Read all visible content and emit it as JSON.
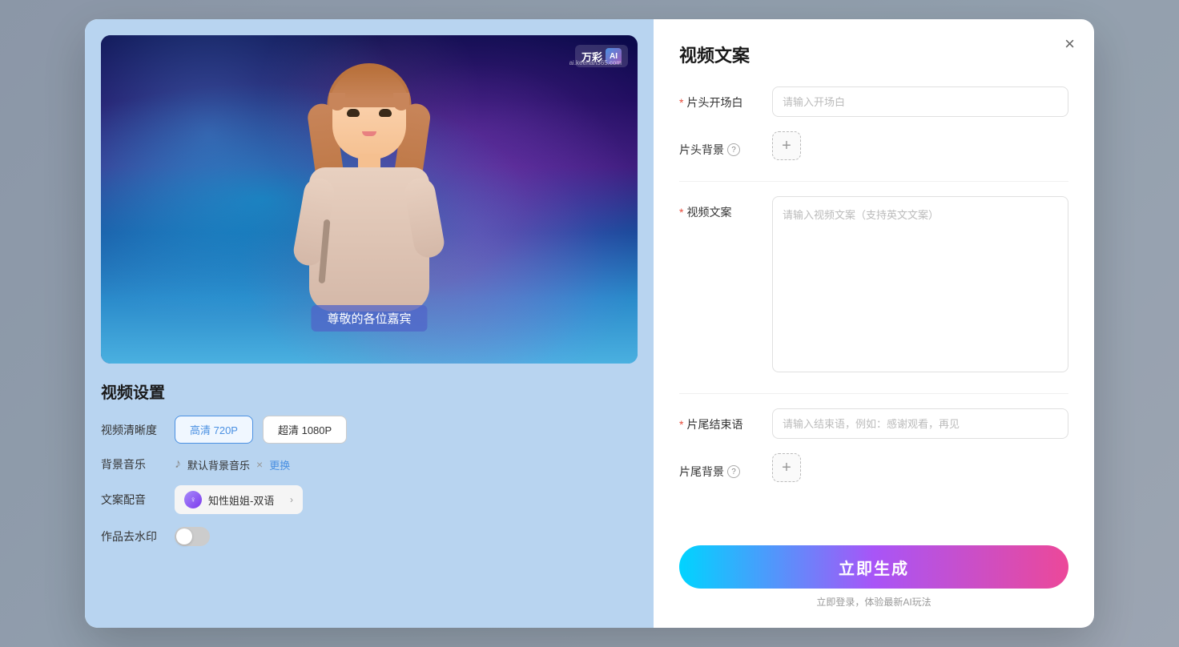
{
  "modal": {
    "close_label": "×",
    "left": {
      "watermark": {
        "brand": "万彩",
        "ai": "AI",
        "url": "ai.keehan365.com"
      },
      "subtitle": "尊敬的各位嘉宾",
      "settings_title": "视频设置",
      "rows": [
        {
          "label": "视频清晰度",
          "type": "quality_buttons",
          "options": [
            "高清 720P",
            "超清 1080P"
          ],
          "active": "高清 720P"
        },
        {
          "label": "背景音乐",
          "type": "music",
          "music_name": "默认背景音乐",
          "change_label": "更换"
        },
        {
          "label": "文案配音",
          "type": "voice",
          "voice_name": "知性姐姐-双语"
        },
        {
          "label": "作品去水印",
          "type": "toggle",
          "enabled": false
        }
      ]
    },
    "right": {
      "title": "视频文案",
      "form": [
        {
          "id": "header_opening",
          "label": "片头开场白",
          "required": true,
          "type": "input",
          "placeholder": "请输入开场白"
        },
        {
          "id": "header_bg",
          "label": "片头背景",
          "required": false,
          "type": "add_button",
          "has_help": true
        },
        {
          "id": "video_copy",
          "label": "视频文案",
          "required": true,
          "type": "textarea",
          "placeholder": "请输入视频文案（支持英文文案）"
        },
        {
          "id": "footer_ending",
          "label": "片尾结束语",
          "required": true,
          "type": "input",
          "placeholder": "请输入结束语，例如：感谢观看，再见"
        },
        {
          "id": "footer_bg",
          "label": "片尾背景",
          "required": false,
          "type": "add_button",
          "has_help": true
        }
      ],
      "generate_button": "立即生成",
      "login_hint_prefix": "立即登录，体验最新AI玩法",
      "login_hint_link": "立即登录"
    }
  }
}
